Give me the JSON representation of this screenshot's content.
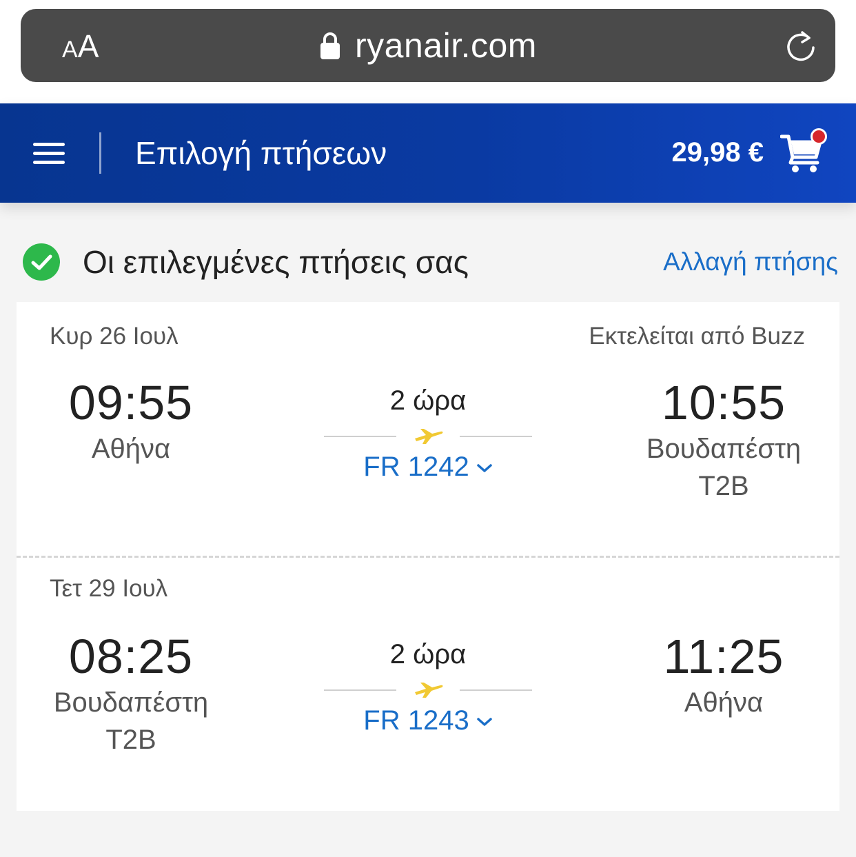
{
  "browser": {
    "text_size_label_small": "A",
    "text_size_label_large": "A",
    "url": "ryanair.com"
  },
  "header": {
    "title": "Επιλογή πτήσεων",
    "cart_total": "29,98 €",
    "colors": {
      "bg_start": "#073590",
      "bg_end": "#1045c0",
      "badge": "#d6262b"
    }
  },
  "section": {
    "title": "Οι επιλεγμένες πτήσεις σας",
    "change_link": "Αλλαγή πτήσης"
  },
  "flights": [
    {
      "date": "Κυρ 26 Ιουλ",
      "operator": "Εκτελείται από Buzz",
      "depart_time": "09:55",
      "depart_city": "Αθήνα",
      "depart_terminal": "",
      "duration": "2 ώρα",
      "flight_number": "FR 1242",
      "arrive_time": "10:55",
      "arrive_city": "Βουδαπέστη",
      "arrive_terminal": "T2B"
    },
    {
      "date": "Τετ 29 Ιουλ",
      "operator": "",
      "depart_time": "08:25",
      "depart_city": "Βουδαπέστη",
      "depart_terminal": "T2B",
      "duration": "2 ώρα",
      "flight_number": "FR 1243",
      "arrive_time": "11:25",
      "arrive_city": "Αθήνα",
      "arrive_terminal": ""
    }
  ],
  "icons": {
    "lock": "lock-icon",
    "reload": "reload-icon",
    "menu": "menu-icon",
    "cart": "cart-icon",
    "check": "check-circle-icon",
    "plane": "plane-icon",
    "chevron": "chevron-down-icon"
  },
  "colors": {
    "link": "#1a6ec8",
    "check": "#2db84b",
    "plane": "#f1c933"
  }
}
